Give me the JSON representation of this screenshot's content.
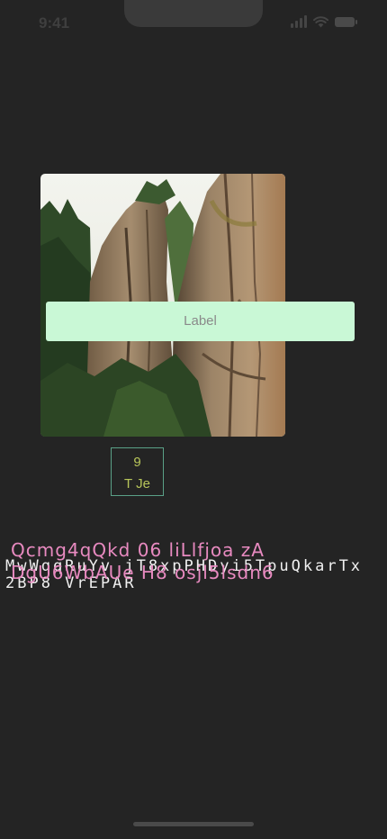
{
  "status_bar": {
    "time": "9:41",
    "icons": [
      "signal-icon",
      "wifi-icon",
      "battery-icon"
    ]
  },
  "photo": {
    "subject": "sandstone-rock-towers"
  },
  "label_button": {
    "label": "Label",
    "background": "#c9f8d6"
  },
  "badge": {
    "number": "9",
    "text": "T Je",
    "border_color": "#5aa087",
    "text_color": "#b8c65a"
  },
  "texts": {
    "mono": "MwWqqRuYv jT8xpPHDyi5TpuQkarTx2BP8 VrEPAR",
    "pink": "Qcmg4qQkd 06 liLlfjoa zA DgU6WbAUe H8 osjl5lsdn6",
    "pink_color": "#e88ac0"
  }
}
